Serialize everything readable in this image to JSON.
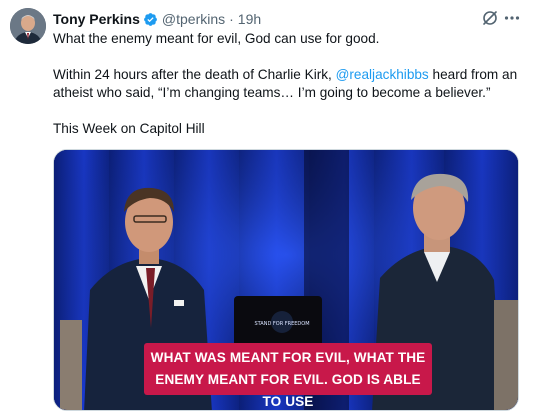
{
  "author": {
    "name": "Tony Perkins",
    "handle": "@tperkins",
    "separator": "·",
    "time": "19h"
  },
  "tweet": {
    "line1": "What the enemy meant for evil, God can use for good.",
    "para2_before": "Within 24 hours after the death of Charlie Kirk, ",
    "mention": "@realjackhibbs",
    "para2_after": " heard from an atheist who said, “I’m changing teams… I’m going to become a believer.”",
    "line3": "This Week on Capitol Hill"
  },
  "media": {
    "caption_line1": "WHAT WAS MEANT FOR EVIL, WHAT THE",
    "caption_line2": "ENEMY MEANT FOR EVIL. GOD IS ABLE TO USE",
    "laptop_sticker": "STAND FOR FREEDOM"
  },
  "icons": [
    "avatar",
    "verified-badge-icon",
    "grok-icon",
    "more-options-icon"
  ],
  "colors": {
    "link": "#1d9bf0",
    "verified": "#1d9bf0",
    "secondary_text": "#536471",
    "caption_bg": "#c8184a",
    "stage_bg": "#0a1a60"
  }
}
